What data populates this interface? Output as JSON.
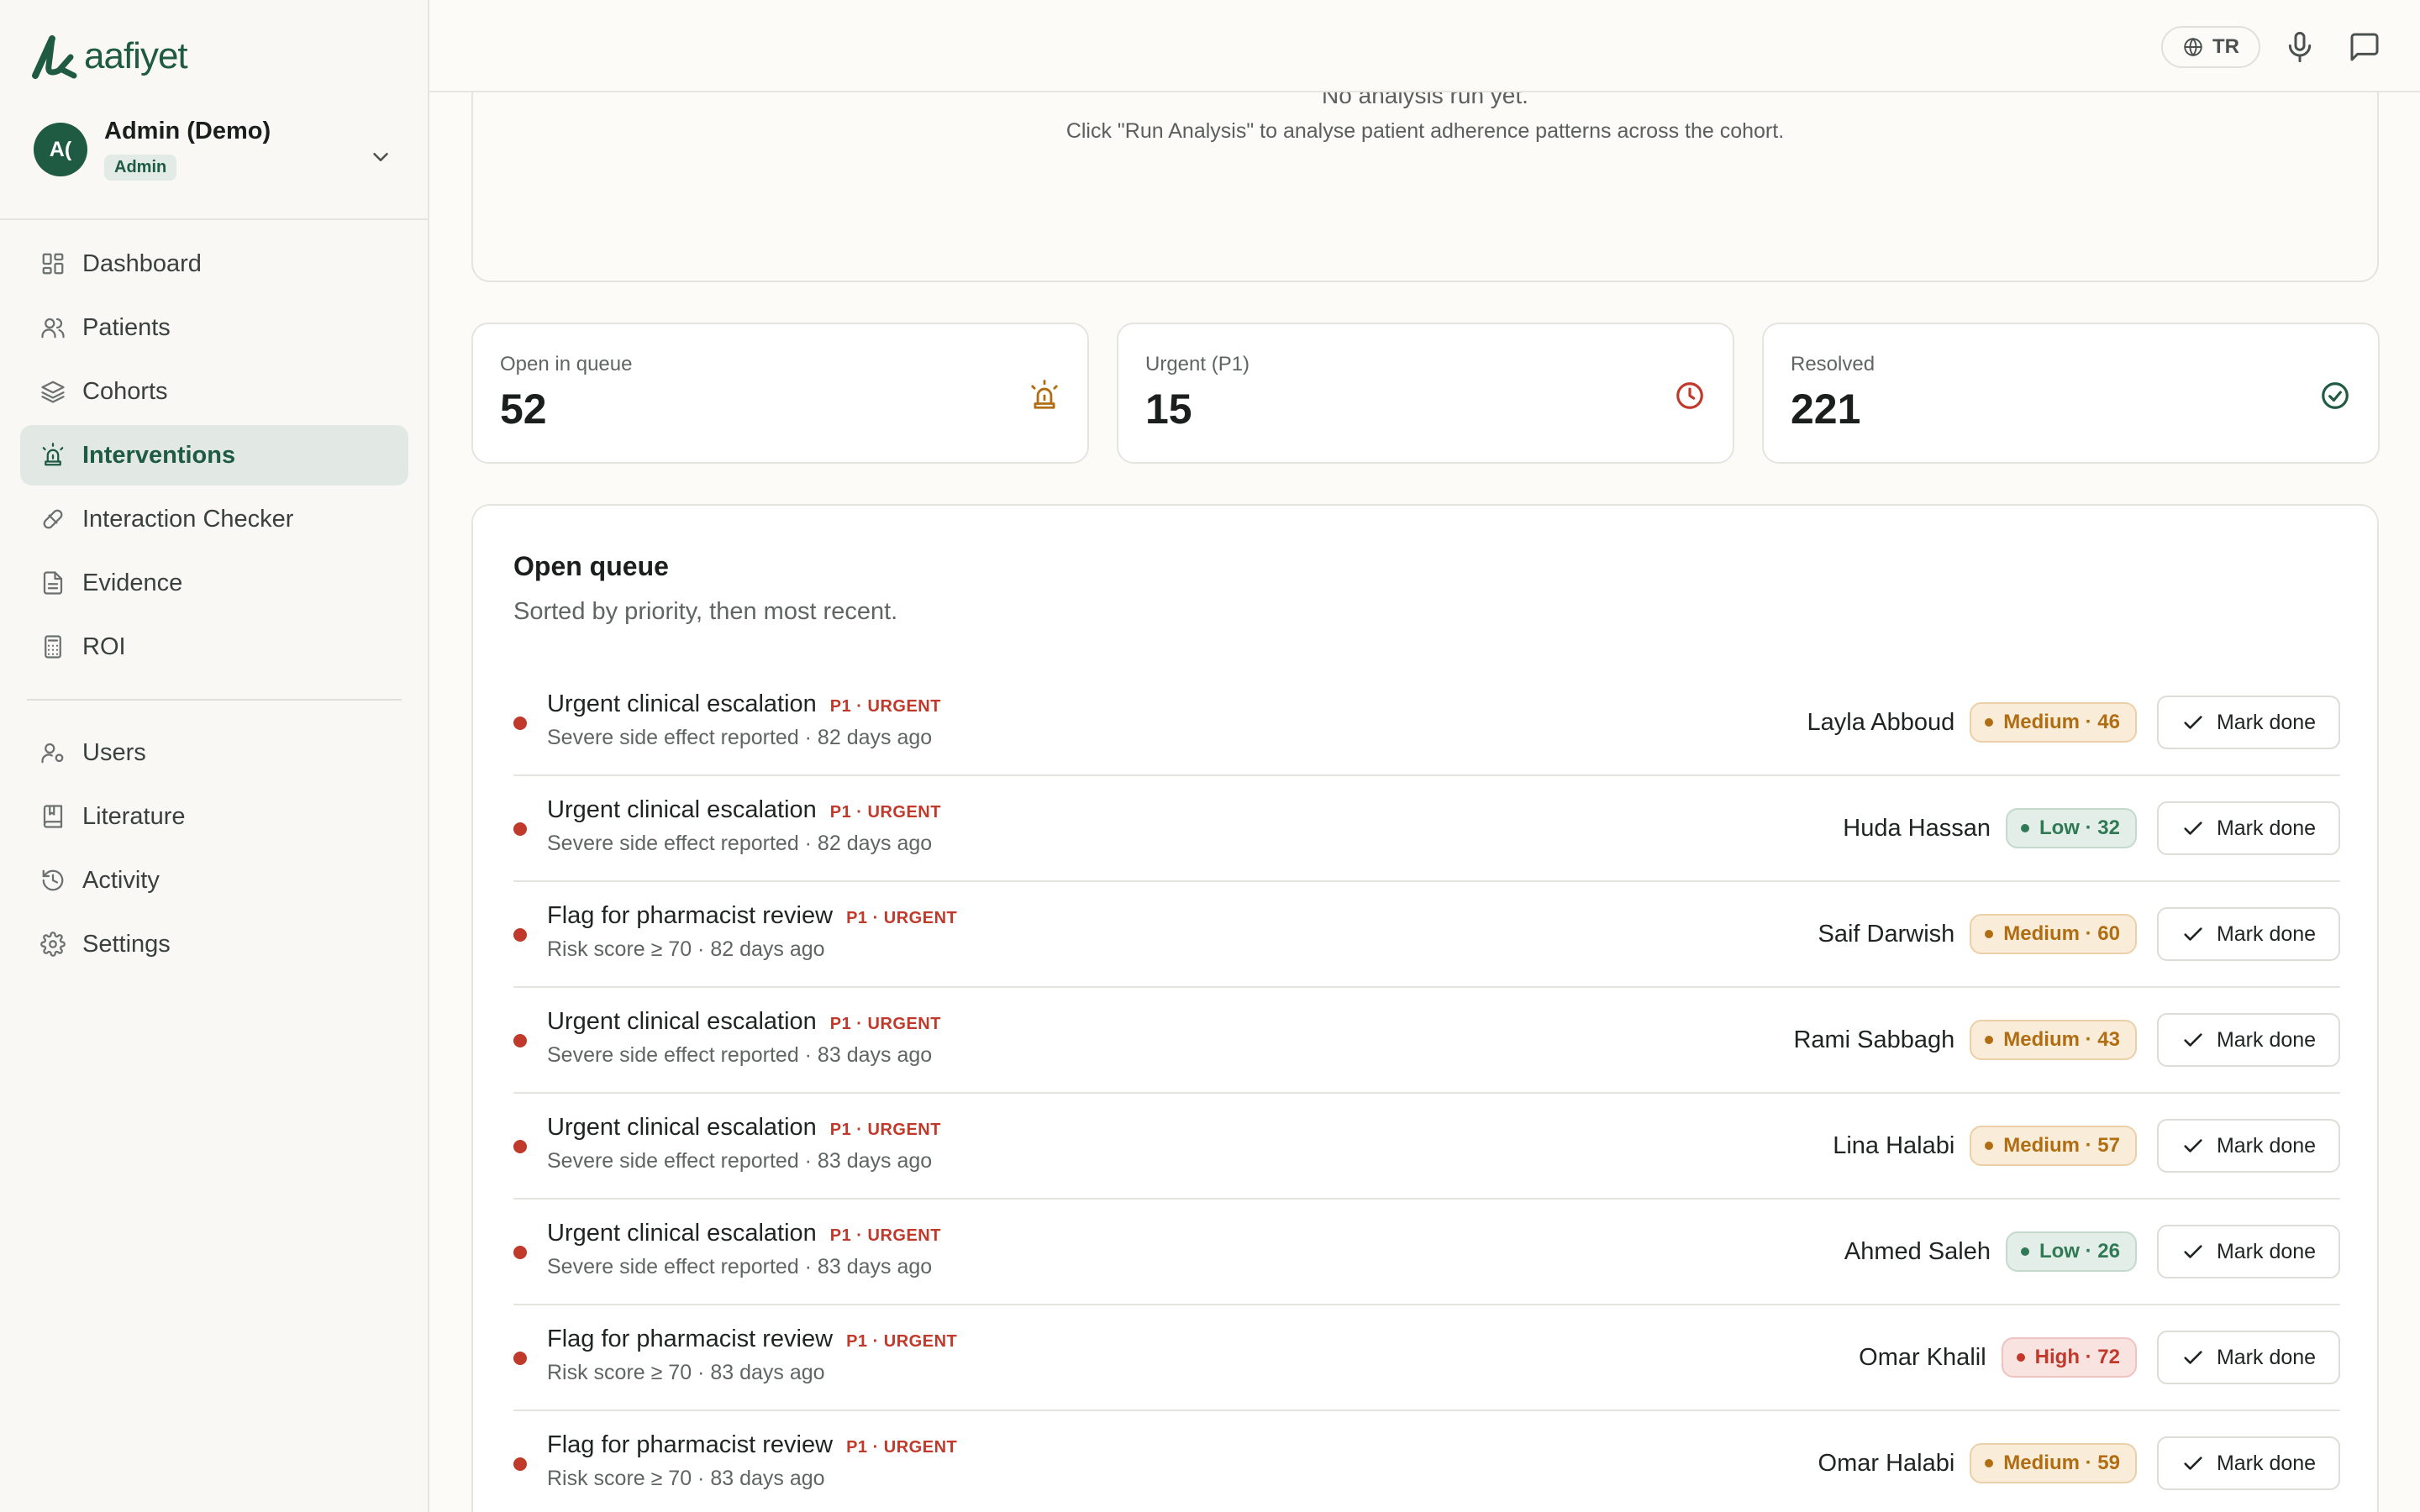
{
  "app": {
    "logo_text": "aafiyet"
  },
  "user": {
    "initials": "A(",
    "name": "Admin (Demo)",
    "role": "Admin"
  },
  "nav": {
    "primary": [
      {
        "label": "Dashboard",
        "icon": "dashboard-icon"
      },
      {
        "label": "Patients",
        "icon": "users-icon"
      },
      {
        "label": "Cohorts",
        "icon": "layers-icon"
      },
      {
        "label": "Interventions",
        "icon": "siren-icon",
        "active": true
      },
      {
        "label": "Interaction Checker",
        "icon": "pill-icon"
      },
      {
        "label": "Evidence",
        "icon": "document-icon"
      },
      {
        "label": "ROI",
        "icon": "calculator-icon"
      }
    ],
    "secondary": [
      {
        "label": "Users",
        "icon": "user-cog-icon"
      },
      {
        "label": "Literature",
        "icon": "book-icon"
      },
      {
        "label": "Activity",
        "icon": "history-icon"
      },
      {
        "label": "Settings",
        "icon": "gear-icon"
      }
    ]
  },
  "topbar": {
    "language": "TR"
  },
  "analysis": {
    "title": "No analysis run yet.",
    "subtitle": "Click \"Run Analysis\" to analyse patient adherence patterns across the cohort."
  },
  "stats": {
    "open": {
      "label": "Open in queue",
      "value": "52",
      "icon": "siren-icon"
    },
    "urgent": {
      "label": "Urgent (P1)",
      "value": "15",
      "icon": "clock-icon"
    },
    "resolved": {
      "label": "Resolved",
      "value": "221",
      "icon": "check-circle-icon"
    }
  },
  "queue": {
    "title": "Open queue",
    "subtitle": "Sorted by priority, then most recent.",
    "button_label": "Mark done",
    "items": [
      {
        "title": "Urgent clinical escalation",
        "tag": "P1 · URGENT",
        "detail": "Severe side effect reported · 82 days ago",
        "patient": "Layla Abboud",
        "risk": "Medium · 46",
        "risk_level": "medium"
      },
      {
        "title": "Urgent clinical escalation",
        "tag": "P1 · URGENT",
        "detail": "Severe side effect reported · 82 days ago",
        "patient": "Huda Hassan",
        "risk": "Low · 32",
        "risk_level": "low"
      },
      {
        "title": "Flag for pharmacist review",
        "tag": "P1 · URGENT",
        "detail": "Risk score ≥ 70 · 82 days ago",
        "patient": "Saif Darwish",
        "risk": "Medium · 60",
        "risk_level": "medium"
      },
      {
        "title": "Urgent clinical escalation",
        "tag": "P1 · URGENT",
        "detail": "Severe side effect reported · 83 days ago",
        "patient": "Rami Sabbagh",
        "risk": "Medium · 43",
        "risk_level": "medium"
      },
      {
        "title": "Urgent clinical escalation",
        "tag": "P1 · URGENT",
        "detail": "Severe side effect reported · 83 days ago",
        "patient": "Lina Halabi",
        "risk": "Medium · 57",
        "risk_level": "medium"
      },
      {
        "title": "Urgent clinical escalation",
        "tag": "P1 · URGENT",
        "detail": "Severe side effect reported · 83 days ago",
        "patient": "Ahmed Saleh",
        "risk": "Low · 26",
        "risk_level": "low"
      },
      {
        "title": "Flag for pharmacist review",
        "tag": "P1 · URGENT",
        "detail": "Risk score ≥ 70 · 83 days ago",
        "patient": "Omar Khalil",
        "risk": "High · 72",
        "risk_level": "high"
      },
      {
        "title": "Flag for pharmacist review",
        "tag": "P1 · URGENT",
        "detail": "Risk score ≥ 70 · 83 days ago",
        "patient": "Omar Halabi",
        "risk": "Medium · 59",
        "risk_level": "medium"
      }
    ]
  }
}
